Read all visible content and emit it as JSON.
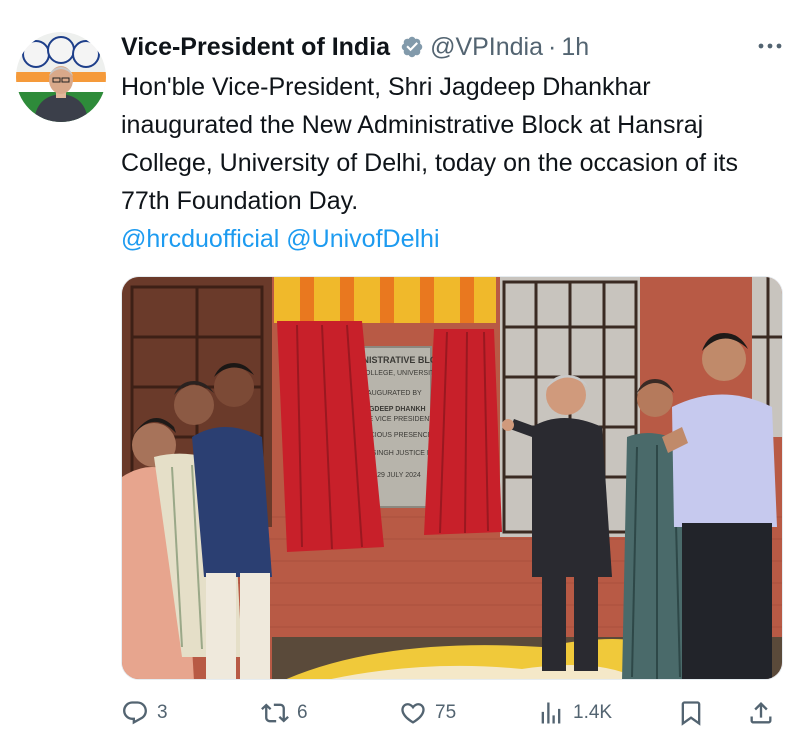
{
  "author": {
    "display_name": "Vice-President of India",
    "handle": "@VPIndia",
    "separator": "·",
    "time": "1h",
    "verified_icon": "verified-badge-icon",
    "colors": {
      "verified": "#829aab",
      "accent": "#1d9bf0"
    }
  },
  "tweet": {
    "text": "Hon'ble Vice-President, Shri Jagdeep Dhankhar inaugurated the New Administrative Block at Hansraj College, University of Delhi, today on the occasion of its 77th Foundation Day.",
    "mentions": [
      "@hrcduofficial",
      "@UnivofDelhi"
    ]
  },
  "media": {
    "plaque_lines": [
      "INISTRATIVE BLO",
      "COLLEGE, UNIVERSITY OF",
      "INAUGURATED BY",
      "JAGDEEP DHANKH",
      "BLE VICE PRESIDENT OF",
      "RACIOUS PRESENCE",
      "SH SINGH   JUSTICE PR",
      "RCH 29 JULY 2024"
    ]
  },
  "actions": {
    "reply": {
      "icon": "reply-icon",
      "count": "3"
    },
    "repost": {
      "icon": "repost-icon",
      "count": "6"
    },
    "like": {
      "icon": "heart-icon",
      "count": "75"
    },
    "views": {
      "icon": "views-icon",
      "count": "1.4K"
    },
    "bookmark": {
      "icon": "bookmark-icon"
    },
    "share": {
      "icon": "share-icon"
    }
  }
}
